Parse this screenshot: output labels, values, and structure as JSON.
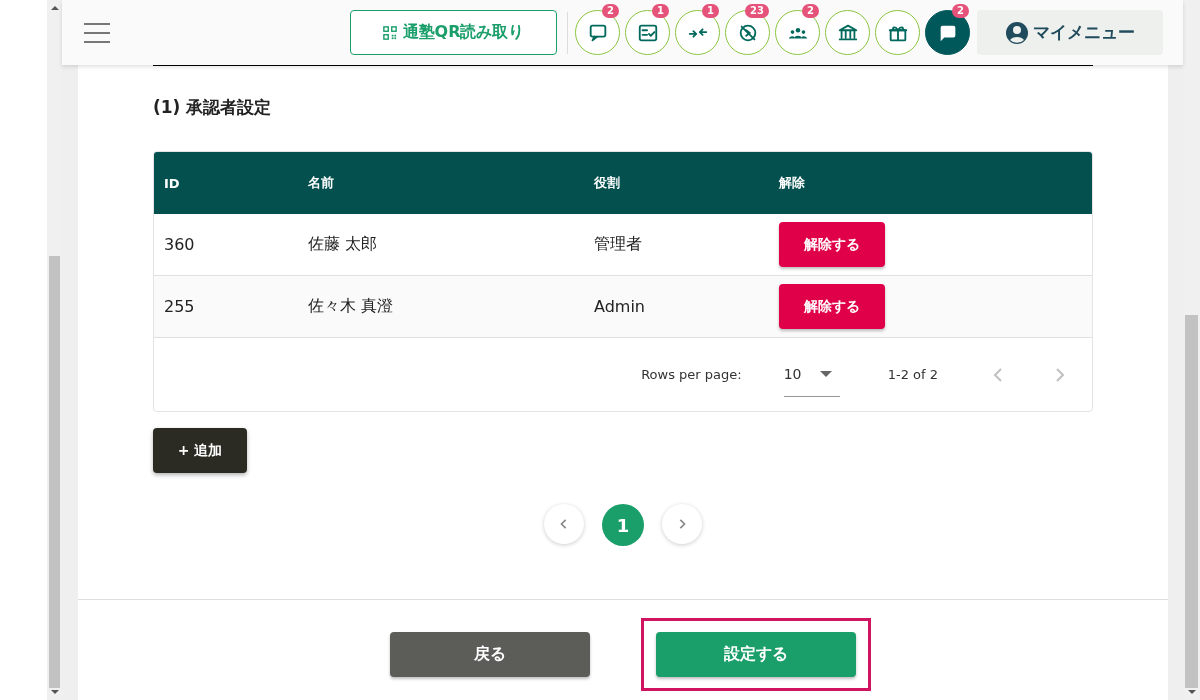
{
  "header": {
    "qr_button": "通塾QR読み取り",
    "icons": [
      {
        "kind": "chat",
        "badge": "2",
        "active": false
      },
      {
        "kind": "checklist",
        "badge": "1",
        "active": false
      },
      {
        "kind": "arrows",
        "badge": "1",
        "active": false
      },
      {
        "kind": "blocked",
        "badge": "23",
        "active": false
      },
      {
        "kind": "group",
        "badge": "2",
        "active": false
      },
      {
        "kind": "bank",
        "active": false
      },
      {
        "kind": "gift",
        "active": false
      },
      {
        "kind": "chat",
        "badge": "2",
        "active": true
      }
    ],
    "my_menu": "マイメニュー"
  },
  "section_title": "(1) 承認者設定",
  "table": {
    "columns": [
      "ID",
      "名前",
      "役割",
      "解除"
    ],
    "rows": [
      {
        "id": "360",
        "name": "佐藤 太郎",
        "role": "管理者",
        "action": "解除する"
      },
      {
        "id": "255",
        "name": "佐々木 真澄",
        "role": "Admin",
        "action": "解除する"
      }
    ],
    "rows_per_page_label": "Rows per page:",
    "rows_per_page": "10",
    "range": "1-2 of 2"
  },
  "add_button": "+ 追加",
  "pagination": {
    "pages": [
      {
        "label": "1",
        "selected": true
      }
    ]
  },
  "footer": {
    "buttons": [
      {
        "label": "戻る",
        "kind": "back",
        "highlighted": false
      },
      {
        "label": "設定する",
        "kind": "primary",
        "highlighted": true
      }
    ]
  }
}
